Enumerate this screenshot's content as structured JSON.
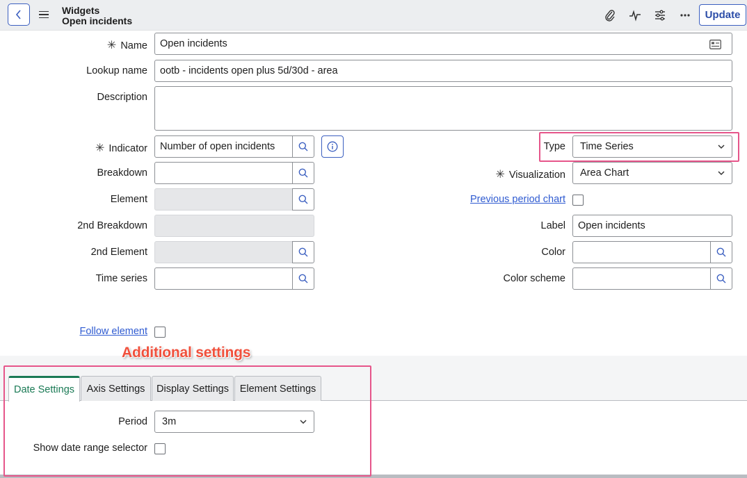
{
  "header": {
    "title_line1": "Widgets",
    "title_line2": "Open incidents",
    "update_label": "Update",
    "icons": [
      "attachment-icon",
      "activity-icon",
      "settings-sliders-icon",
      "more-icon"
    ]
  },
  "form": {
    "name": {
      "label": "Name",
      "value": "Open incidents"
    },
    "lookup_name": {
      "label": "Lookup name",
      "value": "ootb - incidents open plus 5d/30d - area"
    },
    "description": {
      "label": "Description",
      "value": ""
    },
    "indicator": {
      "label": "Indicator",
      "value": "Number of open incidents"
    },
    "breakdown": {
      "label": "Breakdown",
      "value": ""
    },
    "element": {
      "label": "Element",
      "value": ""
    },
    "breakdown_2": {
      "label": "2nd Breakdown",
      "value": ""
    },
    "element_2": {
      "label": "2nd Element",
      "value": ""
    },
    "time_series": {
      "label": "Time series",
      "value": ""
    },
    "type": {
      "label": "Type",
      "value": "Time Series"
    },
    "visualization": {
      "label": "Visualization",
      "value": "Area Chart"
    },
    "previous_period_chart": {
      "label": "Previous period chart",
      "checked": false
    },
    "chart_label": {
      "label": "Label",
      "value": "Open incidents"
    },
    "color": {
      "label": "Color",
      "value": ""
    },
    "color_scheme": {
      "label": "Color scheme",
      "value": ""
    },
    "follow_element": {
      "label": "Follow element",
      "checked": false
    },
    "required_marker": "✳"
  },
  "annotation": "Additional settings",
  "tabs": [
    {
      "label": "Date Settings",
      "active": true
    },
    {
      "label": "Axis Settings",
      "active": false
    },
    {
      "label": "Display Settings",
      "active": false
    },
    {
      "label": "Element Settings",
      "active": false
    }
  ],
  "date_settings": {
    "period": {
      "label": "Period",
      "value": "3m"
    },
    "show_date_range_selector": {
      "label": "Show date range selector",
      "checked": false
    }
  },
  "colors": {
    "accent_blue": "#3b5fc0",
    "link_blue": "#2f5bd1",
    "active_tab_green": "#1a7a55",
    "highlight_pink": "#e6558a",
    "annotation_red": "#f0503c"
  }
}
